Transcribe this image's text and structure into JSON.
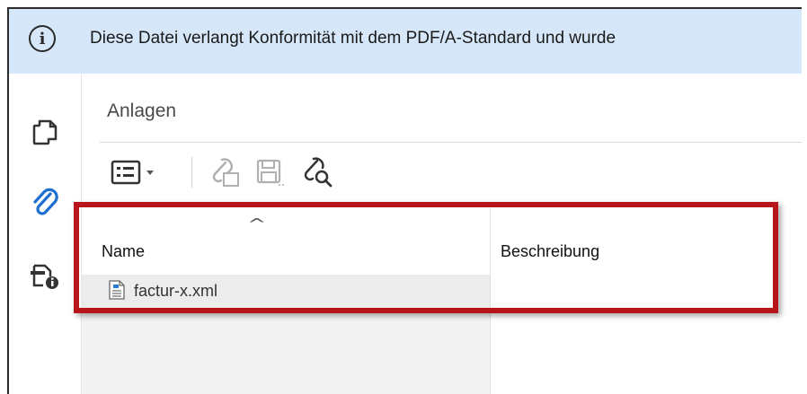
{
  "infobar": {
    "icon": "info-circle-icon",
    "message": "Diese Datei verlangt Konformität mit dem PDF/A-Standard und wurde"
  },
  "leftrail": {
    "items": [
      {
        "icon": "pages-icon"
      },
      {
        "icon": "paperclip-icon",
        "active": true
      },
      {
        "icon": "document-properties-icon"
      }
    ]
  },
  "panel": {
    "title": "Anlagen",
    "toolbar": [
      {
        "icon": "list-options-icon",
        "has_dropdown": true
      },
      {
        "icon": "add-attachment-icon",
        "enabled": false
      },
      {
        "icon": "save-attachment-icon",
        "enabled": false
      },
      {
        "icon": "search-attachment-icon",
        "enabled": true
      }
    ],
    "table": {
      "columns": [
        "Name",
        "Beschreibung"
      ],
      "sort_indicator": "^",
      "rows": [
        {
          "name": "factur-x.xml",
          "description": "",
          "icon": "xml-file-icon"
        }
      ]
    }
  },
  "colors": {
    "infobar_bg": "#d6e7f9",
    "accent_blue": "#1f6fd1",
    "highlight_red": "#b8141c"
  }
}
